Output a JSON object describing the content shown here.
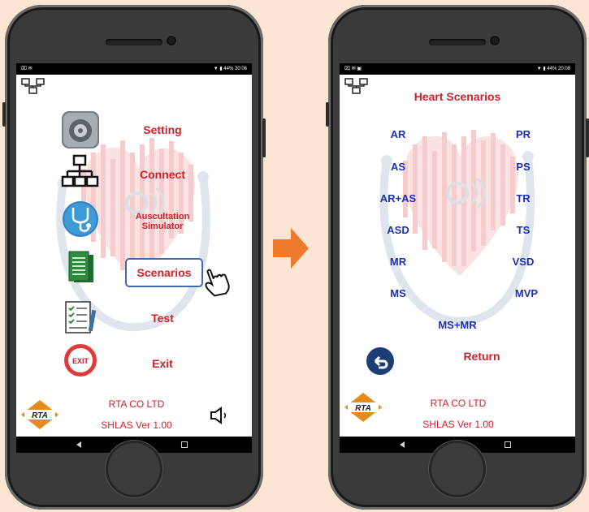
{
  "left_screen": {
    "status_left": "⌧ ✉",
    "status_right": "▼ ▮ 44% 20:06",
    "menu": {
      "setting": "Setting",
      "connect": "Connect",
      "auscultation_line1": "Auscultation",
      "auscultation_line2": "Simulator",
      "scenarios": "Scenarios",
      "test": "Test",
      "exit": "Exit",
      "exit_icon_text": "EXIT"
    },
    "footer": {
      "company": "RTA CO LTD",
      "version": "SHLAS Ver 1.00"
    }
  },
  "right_screen": {
    "status_left": "⌧ ✉ ▣",
    "status_right": "▼ ▮ 44% 20:08",
    "title": "Heart Scenarios",
    "scenarios_left": [
      "AR",
      "AS",
      "AR+AS",
      "ASD",
      "MR",
      "MS"
    ],
    "scenarios_right": [
      "PR",
      "PS",
      "TR",
      "TS",
      "VSD",
      "MVP"
    ],
    "scenario_bottom": "MS+MR",
    "return_label": "Return",
    "footer": {
      "company": "RTA CO LTD",
      "version": "SHLAS Ver 1.00"
    }
  },
  "logo_text": "RTA",
  "colors": {
    "accent_red": "#d0202c",
    "scenario_blue": "#1d2fb3",
    "arrow_orange": "#ee7a2c",
    "highlight_border": "#4468a8"
  }
}
